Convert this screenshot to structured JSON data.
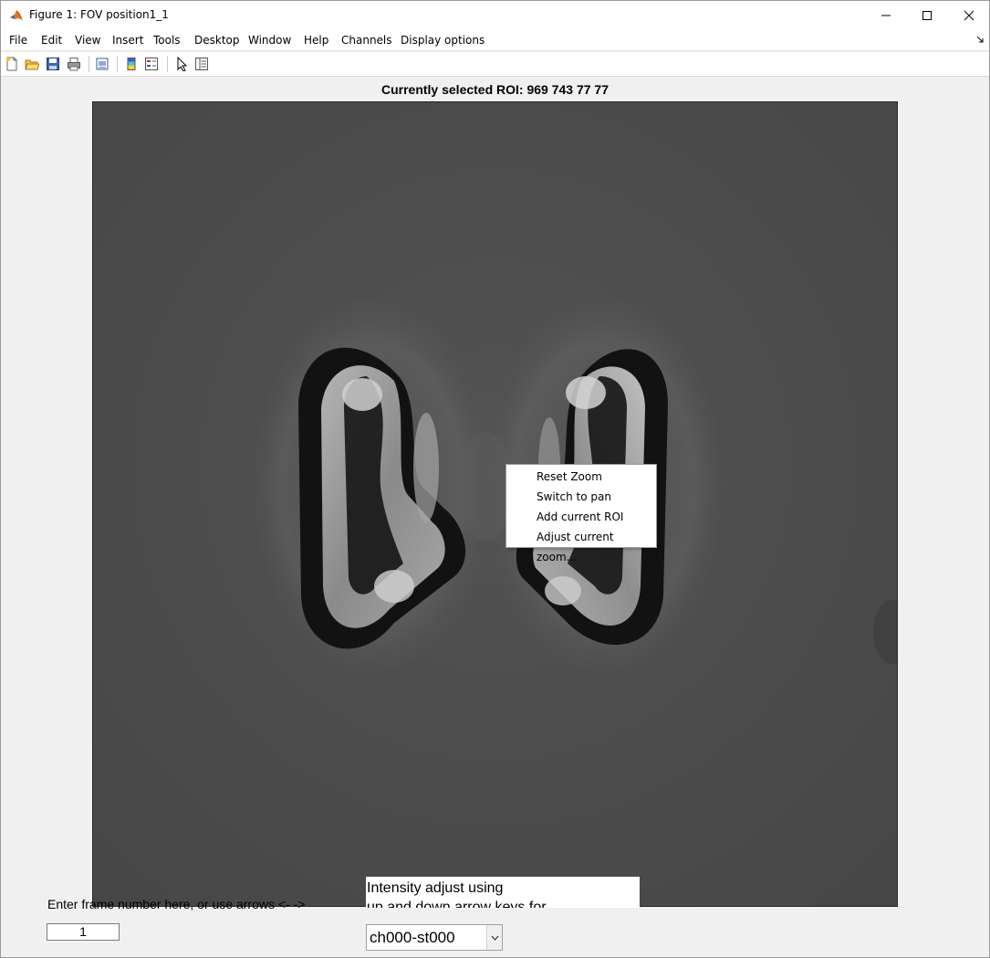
{
  "window": {
    "title": "Figure 1: FOV position1_1",
    "icon": "matlab-logo-icon"
  },
  "menubar": {
    "items": [
      "File",
      "Edit",
      "View",
      "Insert",
      "Tools",
      "Desktop",
      "Window",
      "Help",
      "Channels",
      "Display options"
    ]
  },
  "toolbar": {
    "icons": [
      "new-figure-icon",
      "open-file-icon",
      "save-icon",
      "print-icon",
      "print-preview-icon",
      "colorbar-icon",
      "legend-icon",
      "pointer-icon",
      "property-inspector-icon"
    ]
  },
  "figure": {
    "roi_title": "Currently selected ROI: 969  743   77   77"
  },
  "context_menu": {
    "items": [
      "Reset Zoom",
      "Switch to pan",
      "Add current ROI",
      "Adjust current zoom..."
    ]
  },
  "controls": {
    "frame_label": "Enter frame number here, or use arrows <- ->",
    "frame_value": "1",
    "intensity_line1": "Intensity adjust using",
    "intensity_line2": "up and down arrow keys for",
    "channel_selected": "ch000-st000"
  }
}
